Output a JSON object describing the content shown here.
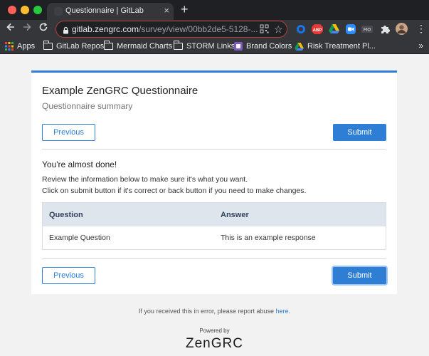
{
  "browser": {
    "tab_title": "Questionnaire | GitLab",
    "tab_close": "×",
    "new_tab": "+",
    "url_host": "gitlab.zengrc.com",
    "url_path": "/survey/view/00bb2de5-5128-...",
    "extensions": [
      "qr-code-icon",
      "star-icon",
      "circle-blue-icon",
      "adblock-icon",
      "google-drive-icon",
      "zoom-icon",
      "fio-icon",
      "puzzle-icon",
      "profile-avatar"
    ],
    "ext_abp": "ABP",
    "ext_fio": "FIO",
    "bookmarks": {
      "apps": "Apps",
      "items": [
        "GitLab Repos",
        "Mermaid Charts",
        "STORM Links",
        "Brand Colors",
        "Risk Treatment Pl..."
      ],
      "overflow": "»"
    }
  },
  "colors": {
    "accent": "#2e7ed6",
    "header_row": "#dfe5ec",
    "title_text": "#222222"
  },
  "questionnaire": {
    "title": "Example ZenGRC Questionnaire",
    "subtitle": "Questionnaire summary",
    "previous_label": "Previous",
    "submit_label": "Submit",
    "almost_done": "You're almost done!",
    "review_line1": "Review the information below to make sure it's what you want.",
    "review_line2": "Click on submit button if it's correct or back button if you need to make changes.",
    "table": {
      "headers": [
        "Question",
        "Answer"
      ],
      "rows": [
        [
          "Example Question",
          "This is an example response"
        ]
      ]
    }
  },
  "footer": {
    "report_text": "If you received this in error, please report abuse ",
    "report_link": "here",
    "report_end": ".",
    "powered_by": "Powered by",
    "logo_zen": "Zen",
    "logo_grc": "GRC"
  }
}
